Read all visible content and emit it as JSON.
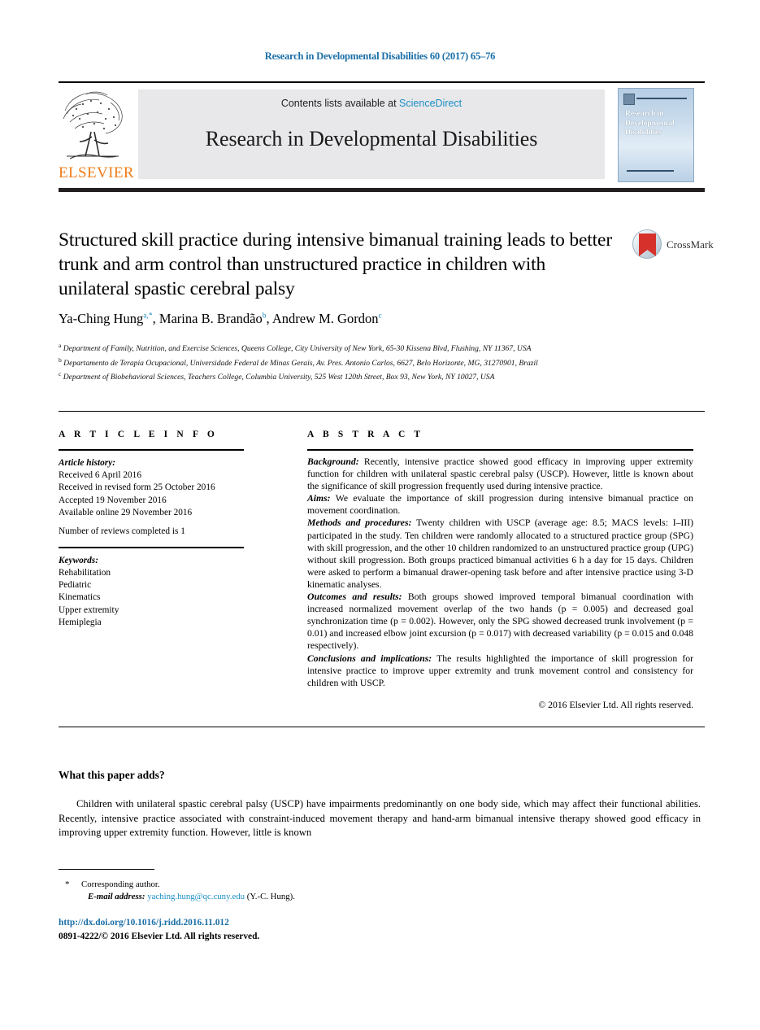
{
  "running_head": "Research in Developmental Disabilities 60 (2017) 65–76",
  "masthead": {
    "contents_prefix": "Contents lists available at ",
    "sciencedirect": "ScienceDirect",
    "journal_title": "Research in Developmental Disabilities",
    "publisher_wordmark": "ELSEVIER",
    "cover_text": "Research in Developmental Disabilities",
    "accent_blue": "#1a8ec4",
    "elsevier_orange": "#ef7d1a",
    "masthead_gray": "#e8e8ea"
  },
  "article": {
    "title": "Structured skill practice during intensive bimanual training leads to better trunk and arm control than unstructured practice in children with unilateral spastic cerebral palsy",
    "authors_html": "Ya-Ching Hung<sup>a,*</sup>, Marina B. Brandão<sup>b</sup>, Andrew M. Gordon<sup>c</sup>",
    "affiliations": [
      {
        "marker": "a",
        "text": "Department of Family, Nutrition, and Exercise Sciences, Queens College, City University of New York, 65-30 Kissena Blvd, Flushing, NY 11367, USA"
      },
      {
        "marker": "b",
        "text": "Departamento de Terapia Ocupacional, Universidade Federal de Minas Gerais, Av. Pres. Antonio Carlos, 6627, Belo Horizonte, MG, 31270901, Brazil"
      },
      {
        "marker": "c",
        "text": "Department of Biobehavioral Sciences, Teachers College, Columbia University, 525 West 120th Street, Box 93, New York, NY 10027, USA"
      }
    ],
    "crossmark_label": "CrossMark"
  },
  "article_info": {
    "heading": "A R T I C L E   I N F O",
    "history_label": "Article history:",
    "history": [
      "Received 6 April 2016",
      "Received in revised form 25 October 2016",
      "Accepted 19 November 2016",
      "Available online 29 November 2016"
    ],
    "reviews_note": "Number of reviews completed is 1",
    "keywords_label": "Keywords:",
    "keywords": [
      "Rehabilitation",
      "Pediatric",
      "Kinematics",
      "Upper extremity",
      "Hemiplegia"
    ]
  },
  "abstract": {
    "heading": "A B S T R A C T",
    "background_label": "Background:",
    "background_text": " Recently, intensive practice showed good efficacy in improving upper extremity function for children with unilateral spastic cerebral palsy (USCP). However, little is known about the significance of skill progression frequently used during intensive practice.",
    "aims_label": "Aims:",
    "aims_text": " We evaluate the importance of skill progression during intensive bimanual practice on movement coordination.",
    "methods_label": "Methods and procedures:",
    "methods_text": " Twenty children with USCP (average age: 8.5; MACS levels: I–III) participated in the study. Ten children were randomly allocated to a structured practice group (SPG) with skill progression, and the other 10 children randomized to an unstructured practice group (UPG) without skill progression. Both groups practiced bimanual activities 6 h a day for 15 days. Children were asked to perform a bimanual drawer-opening task before and after intensive practice using 3-D kinematic analyses.",
    "outcomes_label": "Outcomes and results:",
    "outcomes_text": " Both groups showed improved temporal bimanual coordination with increased normalized movement overlap of the two hands (p = 0.005) and decreased goal synchronization time (p = 0.002). However, only the SPG showed decreased trunk involvement (p = 0.01) and increased elbow joint excursion (p = 0.017) with decreased variability (p = 0.015 and 0.048 respectively).",
    "conclusions_label": "Conclusions and implications:",
    "conclusions_text": " The results highlighted the importance of skill progression for intensive practice to improve upper extremity and trunk movement control and consistency for children with USCP.",
    "copyright": "© 2016 Elsevier Ltd. All rights reserved."
  },
  "what_this_paper_adds": {
    "heading": "What this paper adds?",
    "body": "Children with unilateral spastic cerebral palsy (USCP) have impairments predominantly on one body side, which may affect their functional abilities. Recently, intensive practice associated with constraint-induced movement therapy and hand-arm bimanual intensive therapy showed good efficacy in improving upper extremity function. However, little is known"
  },
  "footer": {
    "corresponding_star": "*",
    "corresponding_label": "Corresponding author.",
    "email_label": "E-mail address:",
    "email": "yaching.hung@qc.cuny.edu",
    "email_owner": "(Y.-C. Hung).",
    "doi": "http://dx.doi.org/10.1016/j.ridd.2016.11.012",
    "issn_line": "0891-4222/© 2016 Elsevier Ltd. All rights reserved."
  }
}
